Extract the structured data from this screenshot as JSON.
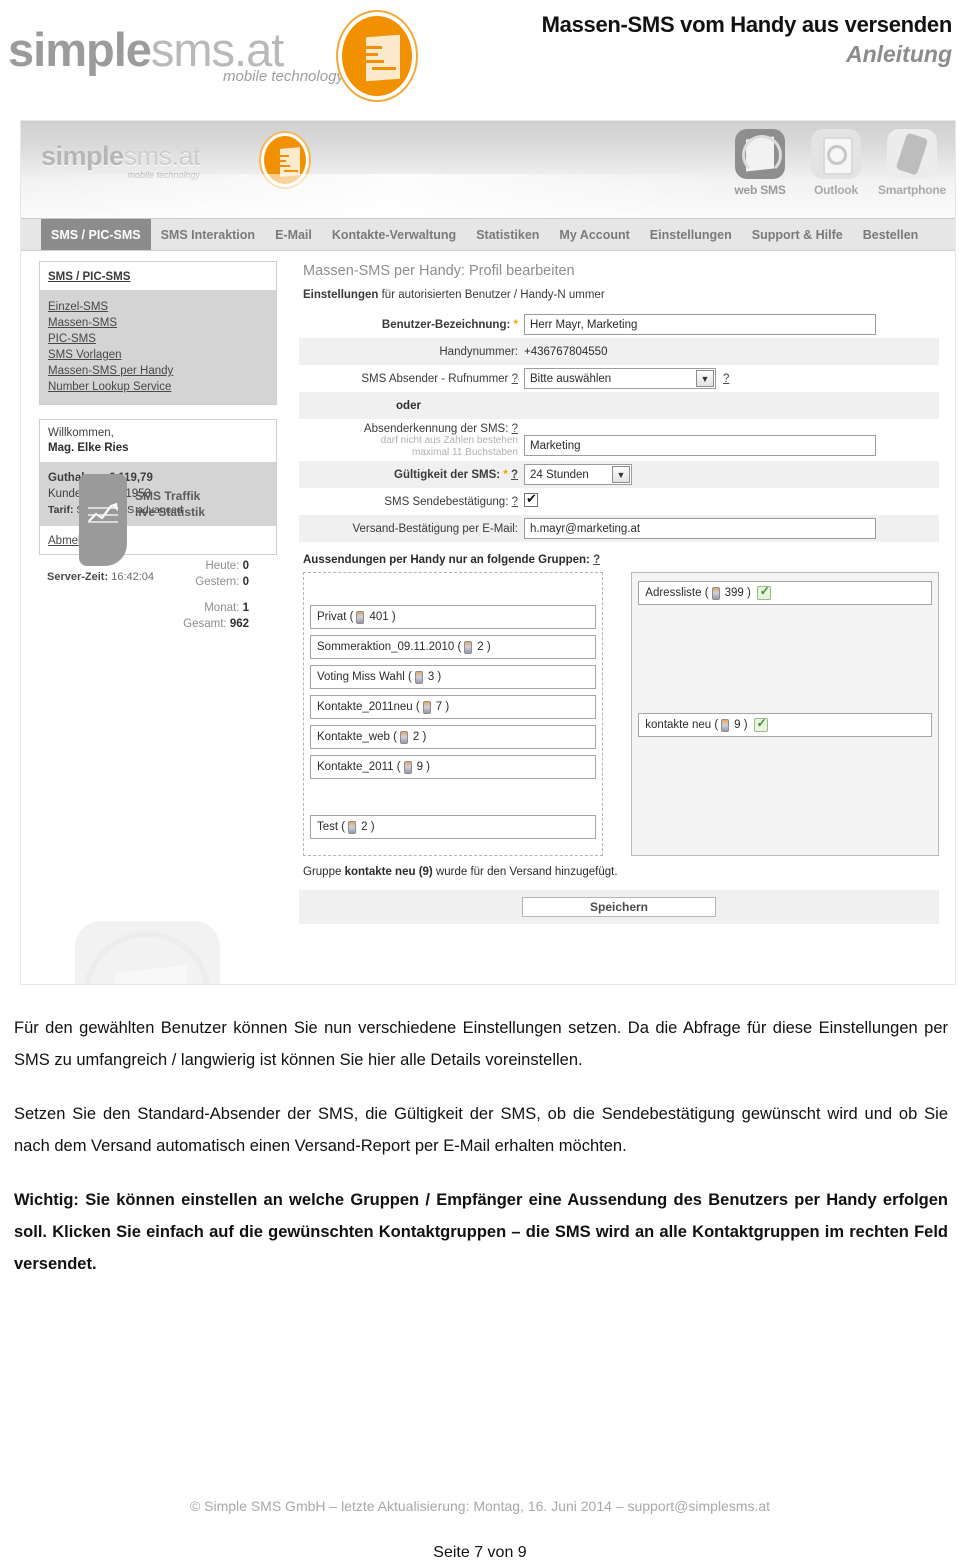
{
  "document": {
    "logo": {
      "simple": "simple",
      "sms": "sms.at",
      "tagline": "mobile technology"
    },
    "title_line1": "Massen-SMS vom Handy aus versenden",
    "title_line2": "Anleitung"
  },
  "app": {
    "logo": {
      "simple": "simple",
      "sms": "sms.at",
      "tagline": "mobile technology"
    },
    "channel_icons": [
      {
        "label": "web SMS",
        "icon": "websms-icon"
      },
      {
        "label": "Outlook",
        "icon": "outlook-icon"
      },
      {
        "label": "Smartphone",
        "icon": "smartphone-icon"
      }
    ],
    "nav": [
      {
        "label": "SMS / PIC-SMS",
        "active": true
      },
      {
        "label": "SMS Interaktion",
        "active": false
      },
      {
        "label": "E-Mail",
        "active": false
      },
      {
        "label": "Kontakte-Verwaltung",
        "active": false
      },
      {
        "label": "Statistiken",
        "active": false
      },
      {
        "label": "My Account",
        "active": false
      },
      {
        "label": "Einstellungen",
        "active": false
      },
      {
        "label": "Support & Hilfe",
        "active": false
      },
      {
        "label": "Bestellen",
        "active": false
      }
    ],
    "sidebar": {
      "section_title": "SMS / PIC-SMS",
      "links": [
        "Einzel-SMS",
        "Massen-SMS",
        "PIC-SMS",
        "SMS Vorlagen",
        "Massen-SMS per Handy",
        "Number Lookup Service"
      ],
      "welcome_label": "Willkommen,",
      "welcome_name": "Mag. Elke Ries",
      "credit_label": "Guthaben:",
      "credit_value": "€ 119,79",
      "customer_label": "Kunden-Nr.:",
      "customer_value": "601953",
      "tariff_label": "Tarif:",
      "tariff_value": "Simple SMS advanced",
      "logout": "Abmelden",
      "server_time_label": "Server-Zeit:",
      "server_time_value": "16:42:04"
    },
    "traffic": {
      "title_line1": "SMS Traffik",
      "title_line2": "live Statistik",
      "rows": [
        {
          "label": "Heute:",
          "value": "0"
        },
        {
          "label": "Gestern:",
          "value": "0"
        },
        {
          "label": "Monat:",
          "value": "1"
        },
        {
          "label": "Gesamt:",
          "value": "962"
        }
      ]
    },
    "form": {
      "page_title": "Massen-SMS per Handy: Profil bearbeiten",
      "sub_bold": "Einstellungen",
      "sub_rest": " für autorisierten Benutzer / Handy-N ummer",
      "user_label": "Benutzer-Bezeichnung:",
      "user_value": "Herr Mayr, Marketing",
      "phone_label": "Handynummer:",
      "phone_value": "+436767804550",
      "sender_number_label": "SMS Absender - Rufnummer",
      "sender_number_value": "Bitte auswählen",
      "or_label": "oder",
      "sender_id_label": "Absenderkennung der SMS:",
      "sender_id_hint1": "darf nicht aus Zahlen bestehen",
      "sender_id_hint2": "maximal 11 Buchstaben",
      "sender_id_value": "Marketing",
      "validity_label": "Gültigkeit der SMS:",
      "validity_value": "24 Stunden",
      "confirm_label": "SMS Sendebestätigung:",
      "email_label": "Versand-Bestätigung per E-Mail:",
      "email_value": "h.mayr@marketing.at",
      "groups_title": "Aussendungen per Handy nur an folgende Gruppen:",
      "help_marker": "?",
      "available_groups": [
        {
          "name": "Privat",
          "count": "401"
        },
        {
          "name": "Sommeraktion_09.11.2010",
          "count": "2"
        },
        {
          "name": "Voting Miss Wahl",
          "count": "3"
        },
        {
          "name": "Kontakte_2011neu",
          "count": "7"
        },
        {
          "name": "Kontakte_web",
          "count": "2"
        },
        {
          "name": "Kontakte_2011",
          "count": "9"
        },
        {
          "name": "Test",
          "count": "2"
        }
      ],
      "selected_groups": [
        {
          "name": "Adressliste",
          "count": "399"
        },
        {
          "name": "kontakte neu",
          "count": "9"
        }
      ],
      "status_prefix": "Gruppe ",
      "status_bold": "kontakte neu (9)",
      "status_suffix": " wurde für den Versand hinzugefügt.",
      "save_label": "Speichern"
    }
  },
  "copy": {
    "p1": "Für den gewählten Benutzer können Sie nun verschiedene Einstellungen setzen. Da die Abfrage für diese Einstellungen per SMS zu umfangreich / langwierig ist können Sie hier alle Details voreinstellen.",
    "p2": "Setzen Sie den Standard-Absender der SMS, die Gültigkeit der SMS, ob die Sendebestätigung gewünscht wird und ob Sie nach dem Versand automatisch einen Versand-Report per E-Mail erhalten möchten.",
    "p3": "Wichtig: Sie können einstellen an welche Gruppen / Empfänger eine Aussendung des Benutzers per Handy erfolgen soll. Klicken Sie einfach auf die gewünschten Kontaktgruppen – die SMS wird an alle Kontaktgruppen im rechten Feld versendet."
  },
  "footer": {
    "line": "© Simple SMS GmbH – letzte Aktualisierung: Montag, 16. Juni 2014 – support@simplesms.at",
    "page": "Seite 7 von 9"
  },
  "colors": {
    "brand_orange": "#f29100",
    "nav_active_bg": "#8c8c8c",
    "panel_gray": "#d4d4d4"
  }
}
